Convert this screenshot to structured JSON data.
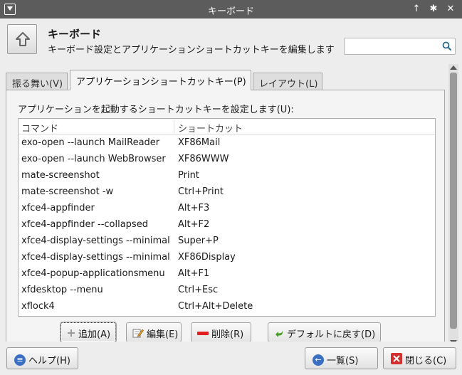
{
  "window": {
    "title": "キーボード",
    "menu_icon": "window-menu-icon",
    "controls": [
      "↑",
      "✱",
      "✕"
    ]
  },
  "header": {
    "icon": "arrow-up-key-icon",
    "title": "キーボード",
    "subtitle": "キーボード設定とアプリケーションショートカットキーを編集します",
    "search_value": "",
    "search_icon": "magnifier-icon"
  },
  "tabs": [
    {
      "label": "振る舞い(V)"
    },
    {
      "label": "アプリケーションショートカットキー(P)",
      "active": true
    },
    {
      "label": "レイアウト(L)"
    }
  ],
  "panel": {
    "label": "アプリケーションを起動するショートカットキーを設定します(U):",
    "columns": [
      "コマンド",
      "ショートカット"
    ],
    "rows": [
      {
        "command": "exo-open --launch MailReader",
        "shortcut": "XF86Mail"
      },
      {
        "command": "exo-open --launch WebBrowser",
        "shortcut": "XF86WWW"
      },
      {
        "command": "mate-screenshot",
        "shortcut": "Print"
      },
      {
        "command": "mate-screenshot -w",
        "shortcut": "Ctrl+Print"
      },
      {
        "command": "xfce4-appfinder",
        "shortcut": "Alt+F3"
      },
      {
        "command": "xfce4-appfinder --collapsed",
        "shortcut": "Alt+F2"
      },
      {
        "command": "xfce4-display-settings --minimal",
        "shortcut": "Super+P"
      },
      {
        "command": "xfce4-display-settings --minimal",
        "shortcut": "XF86Display"
      },
      {
        "command": "xfce4-popup-applicationsmenu",
        "shortcut": "Alt+F1"
      },
      {
        "command": "xfdesktop --menu",
        "shortcut": "Ctrl+Esc"
      },
      {
        "command": "xflock4",
        "shortcut": "Ctrl+Alt+Delete"
      }
    ],
    "buttons": {
      "add": "追加(A)",
      "edit": "編集(E)",
      "delete": "削除(R)",
      "reset": "デフォルトに戻す(D)"
    }
  },
  "bottom": {
    "help": "ヘルプ(H)",
    "overview": "一覧(S)",
    "close": "閉じる(C)"
  },
  "colors": {
    "titlebar": "#5c5c5c",
    "help_icon": "#3b6fc4",
    "overview_icon": "#3b6fc4",
    "close_icon": "#d32f2f",
    "delete_icon": "#e02020",
    "reset_icon": "#4a9a2a"
  }
}
